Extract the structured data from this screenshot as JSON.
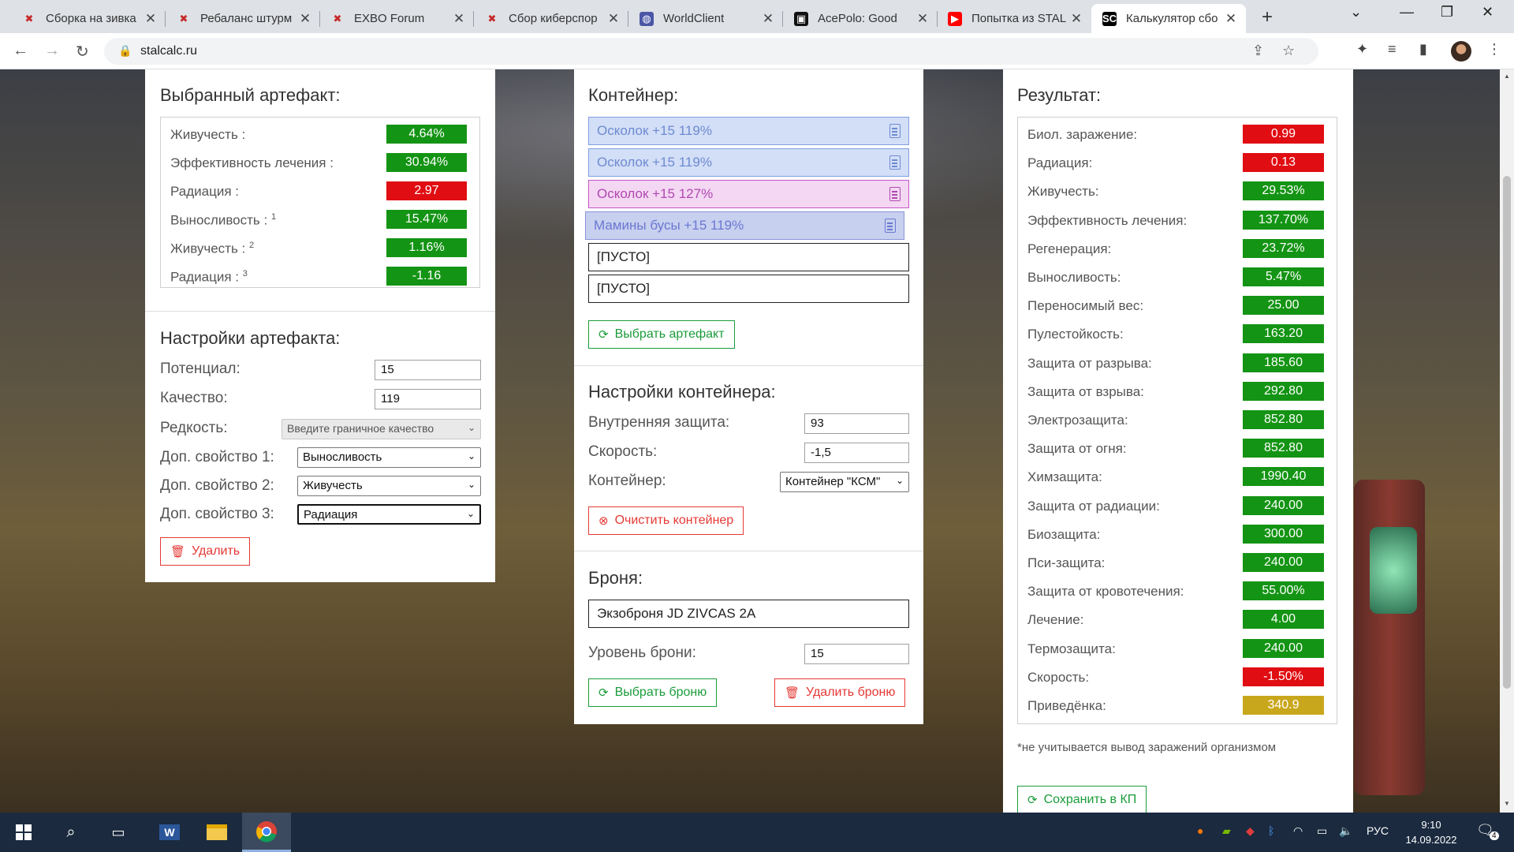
{
  "browser": {
    "tabs": [
      {
        "title": "Сборка на зивка",
        "favicon": "exbo-x-icon"
      },
      {
        "title": "Ребаланс штурм",
        "favicon": "exbo-x-icon"
      },
      {
        "title": "EXBO Forum",
        "favicon": "exbo-x-icon"
      },
      {
        "title": "Сбор киберспор",
        "favicon": "exbo-x-icon"
      },
      {
        "title": "WorldClient",
        "favicon": "globe-icon"
      },
      {
        "title": "AcePolo: Good",
        "favicon": "acepolo-icon"
      },
      {
        "title": "Попытка из STAL",
        "favicon": "youtube-icon"
      },
      {
        "title": "Калькулятор сбо",
        "favicon": "stalcalc-icon",
        "active": true
      }
    ],
    "url": "stalcalc.ru"
  },
  "artifact": {
    "title": "Выбранный артефакт:",
    "stats": [
      {
        "label": "Живучесть :",
        "sup": "",
        "value": "4.64%",
        "color": "green"
      },
      {
        "label": "Эффективность лечения :",
        "sup": "",
        "value": "30.94%",
        "color": "green"
      },
      {
        "label": "Радиация :",
        "sup": "",
        "value": "2.97",
        "color": "red"
      },
      {
        "label": "Выносливость :",
        "sup": "1",
        "value": "15.47%",
        "color": "green"
      },
      {
        "label": "Живучесть :",
        "sup": "2",
        "value": "1.16%",
        "color": "green"
      },
      {
        "label": "Радиация :",
        "sup": "3",
        "value": "-1.16",
        "color": "green"
      }
    ],
    "settings_title": "Настройки артефакта:",
    "potential_label": "Потенциал:",
    "potential_value": "15",
    "quality_label": "Качество:",
    "quality_value": "119",
    "rarity_label": "Редкость:",
    "rarity_value": "Введите граничное качество",
    "prop1_label": "Доп. свойство 1:",
    "prop1_value": "Выносливость",
    "prop2_label": "Доп. свойство 2:",
    "prop2_value": "Живучесть",
    "prop3_label": "Доп. свойство 3:",
    "prop3_value": "Радиация",
    "delete_label": "Удалить"
  },
  "container": {
    "title": "Контейнер:",
    "slots": [
      {
        "label": "Осколок +15 119%",
        "style": "blue"
      },
      {
        "label": "Осколок +15 119%",
        "style": "blue"
      },
      {
        "label": "Осколок +15 127%",
        "style": "pink"
      },
      {
        "label": "Мамины бусы +15 119%",
        "style": "purple"
      },
      {
        "label": "[ПУСТО]",
        "style": "empty"
      },
      {
        "label": "[ПУСТО]",
        "style": "empty"
      }
    ],
    "choose_artifact_label": "Выбрать артефакт",
    "settings_title": "Настройки контейнера:",
    "inner_protection_label": "Внутренняя защита:",
    "inner_protection_value": "93",
    "speed_label": "Скорость:",
    "speed_value": "-1,5",
    "container_label": "Контейнер:",
    "container_value": "Контейнер \"КСМ\"",
    "clear_label": "Очистить контейнер",
    "armor_title": "Броня:",
    "armor_value": "Экзоброня JD ZIVCAS 2A",
    "armor_level_label": "Уровень брони:",
    "armor_level_value": "15",
    "choose_armor_label": "Выбрать броню",
    "delete_armor_label": "Удалить броню"
  },
  "result": {
    "title": "Результат:",
    "stats": [
      {
        "label": "Биол. заражение:",
        "value": "0.99",
        "color": "red"
      },
      {
        "label": "Радиация:",
        "value": "0.13",
        "color": "red"
      },
      {
        "label": "Живучесть:",
        "value": "29.53%",
        "color": "green"
      },
      {
        "label": "Эффективность лечения:",
        "value": "137.70%",
        "color": "green"
      },
      {
        "label": "Регенерация:",
        "value": "23.72%",
        "color": "green"
      },
      {
        "label": "Выносливость:",
        "value": "5.47%",
        "color": "green"
      },
      {
        "label": "Переносимый вес:",
        "value": "25.00",
        "color": "green"
      },
      {
        "label": "Пулестойкость:",
        "value": "163.20",
        "color": "green"
      },
      {
        "label": "Защита от разрыва:",
        "value": "185.60",
        "color": "green"
      },
      {
        "label": "Защита от взрыва:",
        "value": "292.80",
        "color": "green"
      },
      {
        "label": "Электрозащита:",
        "value": "852.80",
        "color": "green"
      },
      {
        "label": "Защита от огня:",
        "value": "852.80",
        "color": "green"
      },
      {
        "label": "Химзащита:",
        "value": "1990.40",
        "color": "green"
      },
      {
        "label": "Защита от радиации:",
        "value": "240.00",
        "color": "green"
      },
      {
        "label": "Биозащита:",
        "value": "300.00",
        "color": "green"
      },
      {
        "label": "Пси-защита:",
        "value": "240.00",
        "color": "green"
      },
      {
        "label": "Защита от кровотечения:",
        "value": "55.00%",
        "color": "green"
      },
      {
        "label": "Лечение:",
        "value": "4.00",
        "color": "green"
      },
      {
        "label": "Термозащита:",
        "value": "240.00",
        "color": "green"
      },
      {
        "label": "Скорость:",
        "value": "-1.50%",
        "color": "red"
      },
      {
        "label": "Приведёнка:",
        "value": "340.9",
        "color": "gold"
      }
    ],
    "note": "*не учитывается вывод заражений организмом",
    "save_label": "Сохранить в КП"
  },
  "taskbar": {
    "lang": "РУС",
    "time": "9:10",
    "date": "14.09.2022",
    "notifications": "4"
  },
  "colors": {
    "green": "#149414",
    "red": "#e00d12",
    "gold": "#c9a71c",
    "accent_green": "#1b9c3a",
    "accent_red": "#e53935"
  }
}
